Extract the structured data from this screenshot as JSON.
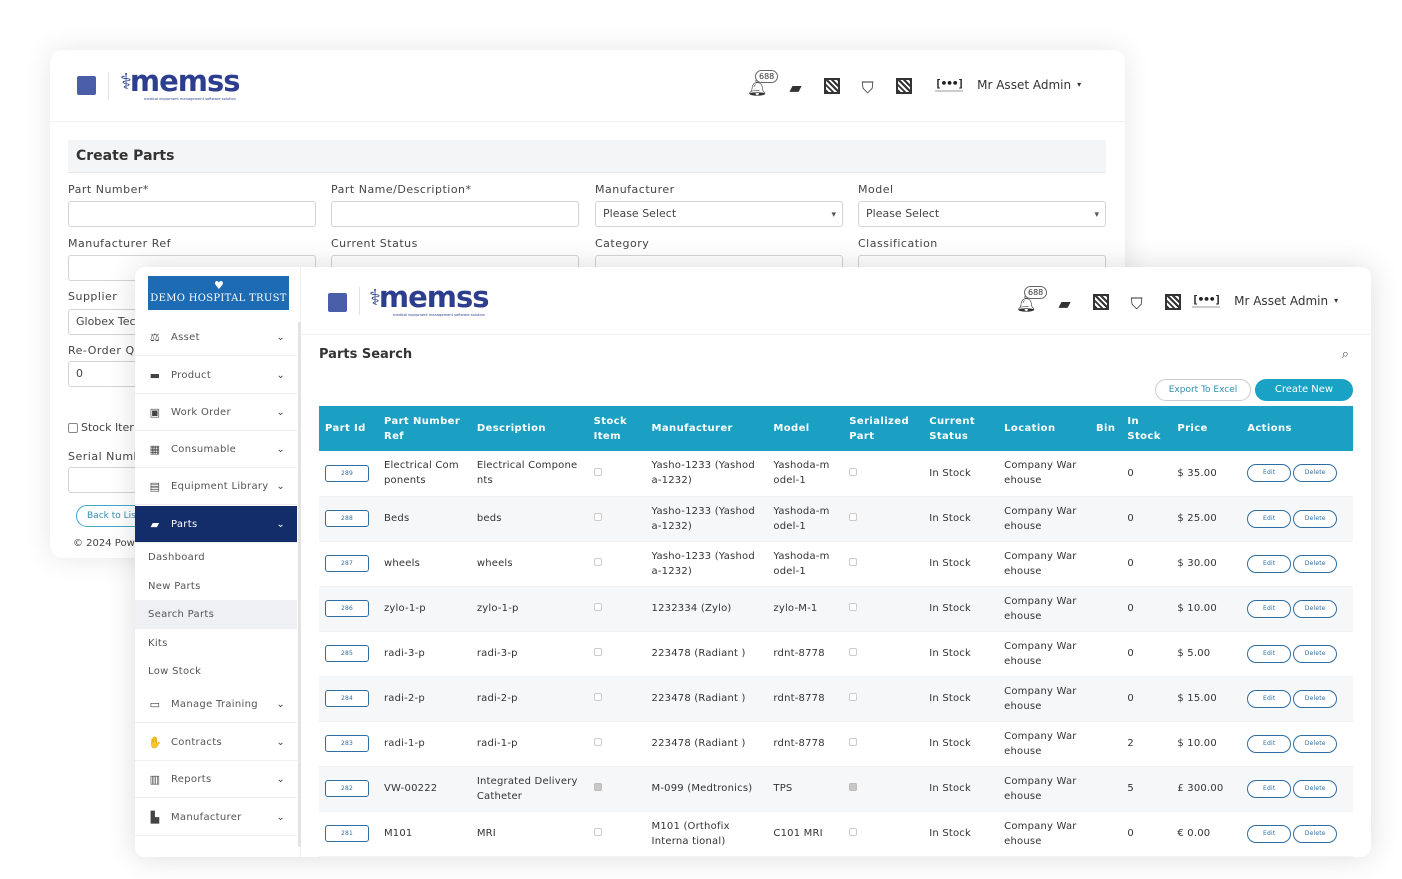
{
  "header": {
    "logo_text": "memss",
    "logo_tagline": "medical equipment management software solution",
    "notification_count": "688",
    "admin_logo": "[•••]",
    "user_name": "Mr Asset Admin"
  },
  "create_parts": {
    "title": "Create Parts",
    "fields": {
      "part_number": {
        "label": "Part Number",
        "required": "*",
        "value": ""
      },
      "part_name": {
        "label": "Part Name/Description",
        "required": "*",
        "value": ""
      },
      "manufacturer": {
        "label": "Manufacturer",
        "value": "Please Select"
      },
      "model": {
        "label": "Model",
        "value": "Please Select"
      },
      "manufacturer_ref": {
        "label": "Manufacturer Ref"
      },
      "current_status": {
        "label": "Current Status"
      },
      "category": {
        "label": "Category"
      },
      "classification": {
        "label": "Classification"
      },
      "supplier": {
        "label": "Supplier",
        "value": "Globex Tec"
      },
      "reorder": {
        "label": "Re-Order Q",
        "value": "0"
      },
      "stock_item": {
        "label": "Stock Iter"
      },
      "serial_number": {
        "label": "Serial Numb"
      }
    },
    "back_button": "Back to Lis",
    "copyright": "© 2024 Powe"
  },
  "sidebar": {
    "trust_name": "DEMO HOSPITAL TRUST",
    "items": [
      {
        "label": "Asset",
        "icon": "asset-icon"
      },
      {
        "label": "Product",
        "icon": "product-icon"
      },
      {
        "label": "Work Order",
        "icon": "work-order-icon"
      },
      {
        "label": "Consumable",
        "icon": "grid-icon"
      },
      {
        "label": "Equipment Library",
        "icon": "library-icon"
      },
      {
        "label": "Parts",
        "icon": "parts-icon"
      },
      {
        "label": "Manage Training",
        "icon": "training-icon"
      },
      {
        "label": "Contracts",
        "icon": "handshake-icon"
      },
      {
        "label": "Reports",
        "icon": "reports-icon"
      },
      {
        "label": "Manufacturer",
        "icon": "chart-icon"
      }
    ],
    "parts_sub": [
      "Dashboard",
      "New Parts",
      "Search Parts",
      "Kits",
      "Low Stock"
    ]
  },
  "parts_search": {
    "title": "Parts Search",
    "export_label": "Export To Excel",
    "create_label": "Create New",
    "columns": [
      "Part Id",
      "Part Number Ref",
      "Description",
      "Stock Item",
      "Manufacturer",
      "Model",
      "Serialized Part",
      "Current Status",
      "Location",
      "Bin",
      "In Stock",
      "Price",
      "Actions"
    ],
    "edit_label": "Edit",
    "delete_label": "Delete",
    "rows": [
      {
        "id": "289",
        "ref": "Electrical Com ponents",
        "desc": "Electrical Compone nts",
        "stock": false,
        "manufacturer": "Yasho-1233 (Yashod a-1232)",
        "model": "Yashoda-m odel-1",
        "serialized": false,
        "status": "In Stock",
        "location": "Company War ehouse",
        "bin": "",
        "in_stock": "0",
        "price": "$ 35.00"
      },
      {
        "id": "288",
        "ref": "Beds",
        "desc": "beds",
        "stock": false,
        "manufacturer": "Yasho-1233 (Yashod a-1232)",
        "model": "Yashoda-m odel-1",
        "serialized": false,
        "status": "In Stock",
        "location": "Company War ehouse",
        "bin": "",
        "in_stock": "0",
        "price": "$ 25.00"
      },
      {
        "id": "287",
        "ref": "wheels",
        "desc": "wheels",
        "stock": false,
        "manufacturer": "Yasho-1233 (Yashod a-1232)",
        "model": "Yashoda-m odel-1",
        "serialized": false,
        "status": "In Stock",
        "location": "Company War ehouse",
        "bin": "",
        "in_stock": "0",
        "price": "$ 30.00"
      },
      {
        "id": "286",
        "ref": "zylo-1-p",
        "desc": "zylo-1-p",
        "stock": false,
        "manufacturer": "1232334 (Zylo)",
        "model": "zylo-M-1",
        "serialized": false,
        "status": "In Stock",
        "location": "Company War ehouse",
        "bin": "",
        "in_stock": "0",
        "price": "$ 10.00"
      },
      {
        "id": "285",
        "ref": "radi-3-p",
        "desc": "radi-3-p",
        "stock": false,
        "manufacturer": "223478 (Radiant )",
        "model": "rdnt-8778",
        "serialized": false,
        "status": "In Stock",
        "location": "Company War ehouse",
        "bin": "",
        "in_stock": "0",
        "price": "$ 5.00"
      },
      {
        "id": "284",
        "ref": "radi-2-p",
        "desc": "radi-2-p",
        "stock": false,
        "manufacturer": "223478 (Radiant )",
        "model": "rdnt-8778",
        "serialized": false,
        "status": "In Stock",
        "location": "Company War ehouse",
        "bin": "",
        "in_stock": "0",
        "price": "$ 15.00"
      },
      {
        "id": "283",
        "ref": "radi-1-p",
        "desc": "radi-1-p",
        "stock": false,
        "manufacturer": "223478 (Radiant )",
        "model": "rdnt-8778",
        "serialized": false,
        "status": "In Stock",
        "location": "Company War ehouse",
        "bin": "",
        "in_stock": "2",
        "price": "$ 10.00"
      },
      {
        "id": "282",
        "ref": "VW-00222",
        "desc": "Integrated Delivery Catheter",
        "stock": true,
        "manufacturer": "M-099 (Medtronics)",
        "model": "TPS",
        "serialized": true,
        "status": "In Stock",
        "location": "Company War ehouse",
        "bin": "",
        "in_stock": "5",
        "price": "£ 300.00"
      },
      {
        "id": "281",
        "ref": "M101",
        "desc": "MRI",
        "stock": false,
        "manufacturer": "M101 (Orthofix Interna tional)",
        "model": "C101 MRI",
        "serialized": false,
        "status": "In Stock",
        "location": "Company War ehouse",
        "bin": "",
        "in_stock": "0",
        "price": "€ 0.00"
      }
    ]
  }
}
